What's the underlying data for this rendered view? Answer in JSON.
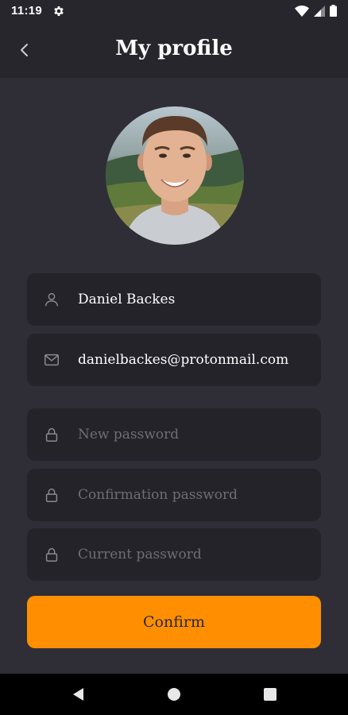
{
  "status_bar": {
    "time": "11:19"
  },
  "header": {
    "title": "My profile"
  },
  "profile": {
    "name": "Daniel Backes",
    "email": "danielbackes@protonmail.com"
  },
  "form": {
    "new_password_placeholder": "New password",
    "confirmation_password_placeholder": "Confirmation password",
    "current_password_placeholder": "Current password"
  },
  "confirm_label": "Confirm",
  "colors": {
    "background": "#2f2e37",
    "header": "#27262c",
    "field": "#24232a",
    "accent": "#ff8f00",
    "placeholder": "#6f6d75"
  }
}
